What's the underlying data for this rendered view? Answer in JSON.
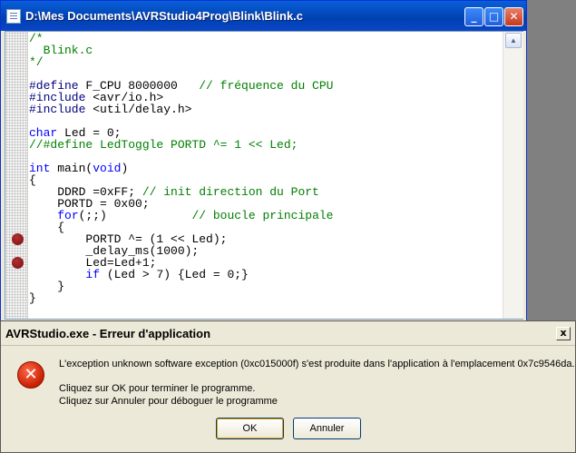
{
  "editor": {
    "title": "D:\\Mes Documents\\AVRStudio4Prog\\Blink\\Blink.c",
    "controls": {
      "minimize": "_",
      "maximize": "□",
      "close": "✕"
    },
    "code_lines": [
      [
        {
          "text": "/*",
          "cls": "tok-c"
        }
      ],
      [
        {
          "text": "  Blink.c",
          "cls": "tok-c"
        }
      ],
      [
        {
          "text": "*/",
          "cls": "tok-c"
        }
      ],
      [
        {
          "text": "",
          "cls": "tok-t"
        }
      ],
      [
        {
          "text": "#define",
          "cls": "tok-p"
        },
        {
          "text": " F_CPU 8000000   ",
          "cls": "tok-t"
        },
        {
          "text": "// fréquence du CPU",
          "cls": "tok-c"
        }
      ],
      [
        {
          "text": "#include",
          "cls": "tok-p"
        },
        {
          "text": " <avr/io.h>",
          "cls": "tok-t"
        }
      ],
      [
        {
          "text": "#include",
          "cls": "tok-p"
        },
        {
          "text": " <util/delay.h>",
          "cls": "tok-t"
        }
      ],
      [
        {
          "text": "",
          "cls": "tok-t"
        }
      ],
      [
        {
          "text": "char",
          "cls": "tok-k"
        },
        {
          "text": " Led = 0;",
          "cls": "tok-t"
        }
      ],
      [
        {
          "text": "//#define LedToggle PORTD ^= 1 << Led;",
          "cls": "tok-c"
        }
      ],
      [
        {
          "text": "",
          "cls": "tok-t"
        }
      ],
      [
        {
          "text": "int",
          "cls": "tok-k"
        },
        {
          "text": " main(",
          "cls": "tok-t"
        },
        {
          "text": "void",
          "cls": "tok-k"
        },
        {
          "text": ")",
          "cls": "tok-t"
        }
      ],
      [
        {
          "text": "{",
          "cls": "tok-t"
        }
      ],
      [
        {
          "text": "    DDRD =0xFF; ",
          "cls": "tok-t"
        },
        {
          "text": "// init direction du Port",
          "cls": "tok-c"
        }
      ],
      [
        {
          "text": "    PORTD = 0x00;",
          "cls": "tok-t"
        }
      ],
      [
        {
          "text": "    ",
          "cls": "tok-t"
        },
        {
          "text": "for",
          "cls": "tok-k"
        },
        {
          "text": "(;;)            ",
          "cls": "tok-t"
        },
        {
          "text": "// boucle principale",
          "cls": "tok-c"
        }
      ],
      [
        {
          "text": "    {",
          "cls": "tok-t"
        }
      ],
      [
        {
          "text": "        PORTD ^= (1 << Led);",
          "cls": "tok-t"
        }
      ],
      [
        {
          "text": "        _delay_ms(1000);",
          "cls": "tok-t"
        }
      ],
      [
        {
          "text": "        Led=Led+1;",
          "cls": "tok-t"
        }
      ],
      [
        {
          "text": "        ",
          "cls": "tok-t"
        },
        {
          "text": "if",
          "cls": "tok-k"
        },
        {
          "text": " (Led > 7) {Led = 0;}",
          "cls": "tok-t"
        }
      ],
      [
        {
          "text": "    }",
          "cls": "tok-t"
        }
      ],
      [
        {
          "text": "}",
          "cls": "tok-t"
        }
      ]
    ],
    "breakpoint_lines": [
      17,
      19
    ]
  },
  "dialog": {
    "title": "AVRStudio.exe - Erreur d'application",
    "close_label": "x",
    "icon": "error-icon",
    "icon_glyph": "✕",
    "message": "L'exception unknown software exception (0xc015000f) s'est produite dans l'application à l'emplacement 0x7c9546da.",
    "ok_hint": "Cliquez sur OK pour terminer le programme.",
    "cancel_hint": "Cliquez sur Annuler pour déboguer le programme",
    "ok_label": "OK",
    "cancel_label": "Annuler"
  }
}
